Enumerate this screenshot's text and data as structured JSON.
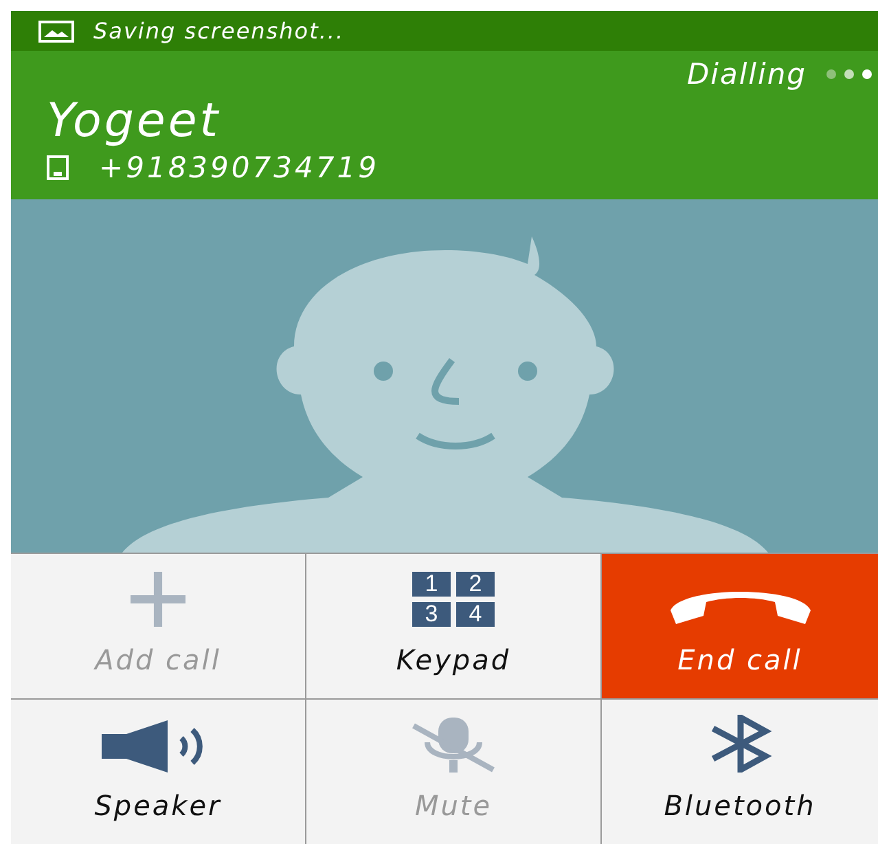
{
  "status_bar": {
    "notification": "Saving screenshot..."
  },
  "call": {
    "status": "Dialling",
    "name": "Yogeet",
    "number": "+918390734719"
  },
  "buttons": [
    {
      "kind": "add",
      "label": "Add call",
      "disabled": true
    },
    {
      "kind": "keypad",
      "label": "Keypad",
      "disabled": false,
      "keys": [
        "1",
        "2",
        "3",
        "4"
      ]
    },
    {
      "kind": "end",
      "label": "End call",
      "disabled": false
    },
    {
      "kind": "speaker",
      "label": "Speaker",
      "disabled": false
    },
    {
      "kind": "mute",
      "label": "Mute",
      "disabled": true
    },
    {
      "kind": "bluetooth",
      "label": "Bluetooth",
      "disabled": false
    }
  ]
}
